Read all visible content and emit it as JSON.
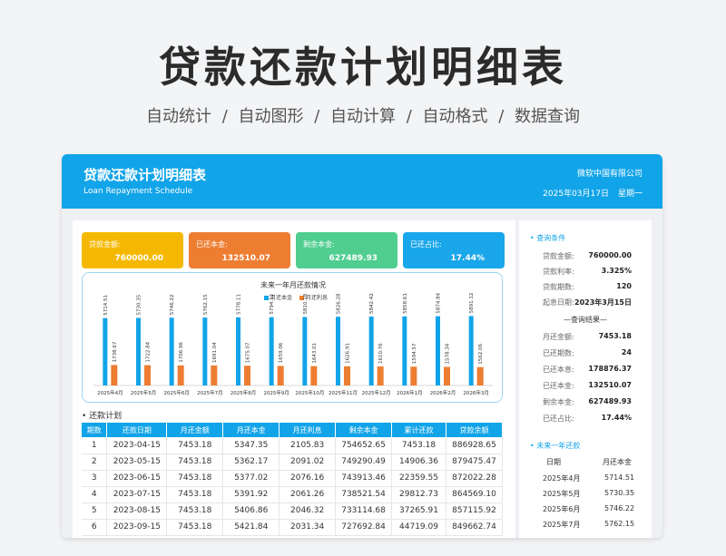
{
  "hero": {
    "title": "贷款还款计划明细表",
    "subtitle": "自动统计  /  自动图形  /  自动计算  /  自动格式  /  数据查询"
  },
  "header": {
    "title": "贷款还款计划明细表",
    "subtitle": "Loan Repayment Schedule",
    "company": "微软中国有限公司",
    "date": "2025年03月17日",
    "weekday": "星期一"
  },
  "kpis": [
    {
      "label": "贷款金额:",
      "value": "760000.00",
      "color": "#f5b800"
    },
    {
      "label": "已还本金:",
      "value": "132510.07",
      "color": "#ed7d31"
    },
    {
      "label": "剩余本金:",
      "value": "627489.93",
      "color": "#4fce8f"
    },
    {
      "label": "已还占比:",
      "value": "17.44%",
      "color": "#1aa6ea"
    }
  ],
  "chart_data": {
    "type": "bar",
    "title": "未来一年月还款情况",
    "categories": [
      "2025年4月",
      "2025年5月",
      "2025年6月",
      "2025年7月",
      "2025年8月",
      "2025年9月",
      "2025年10月",
      "2025年11月",
      "2025年12月",
      "2026年1月",
      "2026年2月",
      "2026年3月"
    ],
    "series": [
      {
        "name": "月还本金",
        "color": "#12a4e8",
        "values": [
          5714.51,
          5730.35,
          5746.22,
          5762.15,
          5778.11,
          5794.12,
          5810.18,
          5826.28,
          5842.42,
          5858.61,
          5874.84,
          5891.12
        ]
      },
      {
        "name": "月还利息",
        "color": "#ed7d31",
        "values": [
          1738.67,
          1722.84,
          1706.96,
          1691.04,
          1675.07,
          1659.06,
          1643.01,
          1626.91,
          1610.76,
          1594.57,
          1578.34,
          1562.06
        ]
      }
    ]
  },
  "table": {
    "section_title": "• 还款计划",
    "headers": [
      "期数",
      "还款日期",
      "月还金额",
      "月还本金",
      "月还利息",
      "剩余本金",
      "累计还款",
      "贷款余额"
    ],
    "rows": [
      [
        "1",
        "2023-04-15",
        "7453.18",
        "5347.35",
        "2105.83",
        "754652.65",
        "7453.18",
        "886928.65"
      ],
      [
        "2",
        "2023-05-15",
        "7453.18",
        "5362.17",
        "2091.02",
        "749290.49",
        "14906.36",
        "879475.47"
      ],
      [
        "3",
        "2023-06-15",
        "7453.18",
        "5377.02",
        "2076.16",
        "743913.46",
        "22359.55",
        "872022.28"
      ],
      [
        "4",
        "2023-07-15",
        "7453.18",
        "5391.92",
        "2061.26",
        "738521.54",
        "29812.73",
        "864569.10"
      ],
      [
        "5",
        "2023-08-15",
        "7453.18",
        "5406.86",
        "2046.32",
        "733114.68",
        "37265.91",
        "857115.92"
      ],
      [
        "6",
        "2023-09-15",
        "7453.18",
        "5421.84",
        "2031.34",
        "727692.84",
        "44719.09",
        "849662.74"
      ]
    ]
  },
  "query": {
    "title": "• 查询条件",
    "conditions": [
      {
        "label": "贷款金额:",
        "value": "760000.00"
      },
      {
        "label": "贷款利率:",
        "value": "3.325%"
      },
      {
        "label": "贷款期数:",
        "value": "120"
      },
      {
        "label": "起息日期:",
        "value": "2023年3月15日"
      }
    ],
    "results_title": "—查询结果—",
    "results": [
      {
        "label": "月还金额:",
        "value": "7453.18"
      },
      {
        "label": "已还期数:",
        "value": "24"
      },
      {
        "label": "已还本息:",
        "value": "178876.37"
      },
      {
        "label": "已还本金:",
        "value": "132510.07"
      },
      {
        "label": "剩余本金:",
        "value": "627489.93"
      },
      {
        "label": "已还占比:",
        "value": "17.44%"
      }
    ]
  },
  "forecast": {
    "title": "• 未来一年还款",
    "col_date": "日期",
    "col_amount": "月还本金",
    "rows": [
      {
        "date": "2025年4月",
        "amount": "5714.51"
      },
      {
        "date": "2025年5月",
        "amount": "5730.35"
      },
      {
        "date": "2025年6月",
        "amount": "5746.22"
      },
      {
        "date": "2025年7月",
        "amount": "5762.15"
      }
    ]
  }
}
